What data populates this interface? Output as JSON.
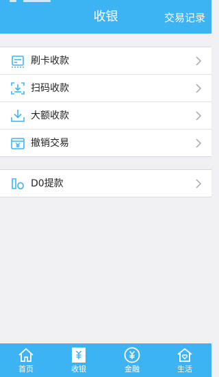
{
  "header": {
    "title": "收银",
    "history_link": "交易记录"
  },
  "menu": [
    {
      "label": "刷卡收款",
      "icon": "card-swipe-icon"
    },
    {
      "label": "扫码收款",
      "icon": "scan-icon"
    },
    {
      "label": "大额收款",
      "icon": "download-icon"
    },
    {
      "label": "撤销交易",
      "icon": "revoke-icon"
    }
  ],
  "withdraw": {
    "label": "D0提款",
    "icon": "d0-icon"
  },
  "tabs": [
    {
      "label": "首页",
      "icon": "home-icon"
    },
    {
      "label": "收银",
      "icon": "cashier-icon"
    },
    {
      "label": "金融",
      "icon": "finance-icon"
    },
    {
      "label": "生活",
      "icon": "life-icon"
    }
  ],
  "colors": {
    "accent": "#3db3f3",
    "background": "#efeff4",
    "chevron": "#a6a6a6"
  }
}
